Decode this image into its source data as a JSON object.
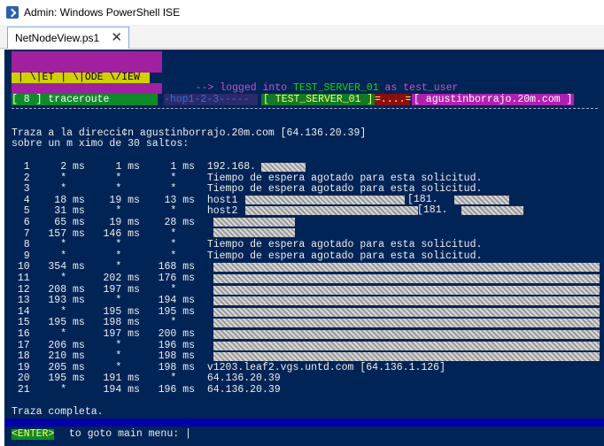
{
  "window": {
    "title": "Admin: Windows PowerShell ISE"
  },
  "tab": {
    "label": "NetNodeView.ps1",
    "close": "✕"
  },
  "banner": {
    "logo": " | \\|ET | \\|ODE \\/IEW ",
    "logged_arrow": "--> logged into ",
    "server": "TEST_SERVER_01",
    "as": " as ",
    "user": "test_user"
  },
  "menu": {
    "item": "[ 8 ] traceroute"
  },
  "status": {
    "hop": "-hop1-2-3-----",
    "server": "[ TEST_SERVER_01 ]",
    "dots": "=....=",
    "host": "[ agustinborrajo.20m.com ]"
  },
  "trace": {
    "header1": "Traza a la direcci¢n agustinborrajo.20m.com [64.136.20.39]",
    "header2": "sobre un m ximo de 30 saltos:",
    "rows": [
      "  1     2 ms     1 ms     1 ms  192.168.",
      "  2     *        *        *     Tiempo de espera agotado para esta solicitud.",
      "  3     *        *        *     Tiempo de espera agotado para esta solicitud.",
      "  4    18 ms    19 ms    13 ms  host1",
      "  5    31 ms     *        *     host2",
      "  6    65 ms    19 ms    28 ms",
      "  7   157 ms   146 ms     *",
      "  8     *        *        *     Tiempo de espera agotado para esta solicitud.",
      "  9     *        *        *     Tiempo de espera agotado para esta solicitud.",
      " 10   354 ms     *      168 ms",
      " 11     *      202 ms   176 ms",
      " 12   208 ms   197 ms     *",
      " 13   193 ms     *      194 ms",
      " 14     *      195 ms   195 ms",
      " 15   195 ms   198 ms     *",
      " 16     *      197 ms   200 ms",
      " 17   206 ms     *      196 ms",
      " 18   210 ms     *      198 ms",
      " 19   205 ms     *      198 ms  v1203.leaf2.vgs.untd.com [64.136.1.126]",
      " 20   195 ms   191 ms     *     64.136.20.39",
      " 21     *      194 ms   196 ms  64.136.20.39"
    ],
    "host1_suffix": "[181.",
    "host2_suffix": "[181.",
    "footer": "Traza completa."
  },
  "prompt": {
    "key": "<ENTER>",
    "text": " to goto main menu: |"
  }
}
